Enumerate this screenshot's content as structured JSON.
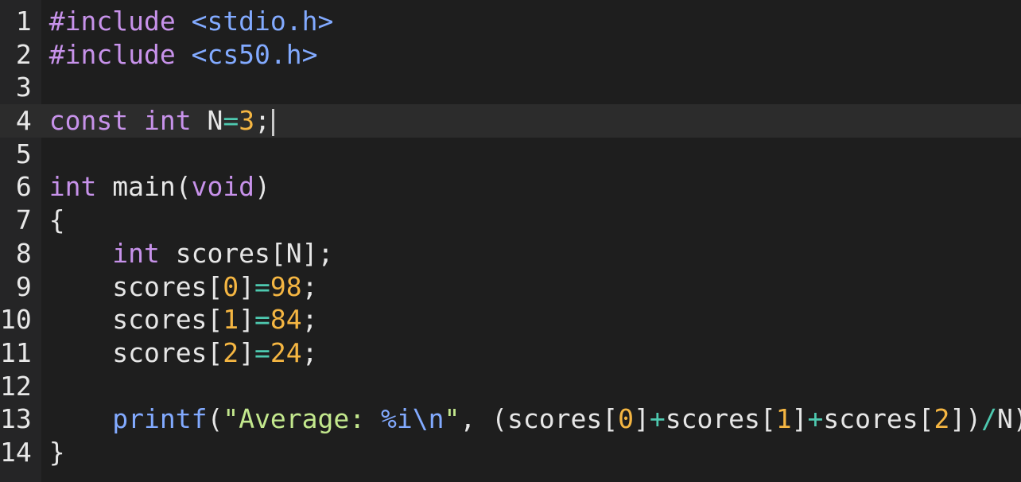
{
  "colors": {
    "background": "#1e1e1e",
    "gutter": "#252526",
    "keyword": "#c792ea",
    "directive": "#c792ea",
    "header": "#82aaff",
    "number": "#f5b642",
    "operator": "#4ec9b0",
    "plain": "#e6e6e6",
    "function": "#82aaff",
    "string": "#c3e88d"
  },
  "editor": {
    "active_line": 4,
    "line_numbers": [
      "1",
      "2",
      "3",
      "4",
      "5",
      "6",
      "7",
      "8",
      "9",
      "10",
      "11",
      "12",
      "13",
      "14"
    ],
    "lines": [
      [
        {
          "t": "#include",
          "c": "directive"
        },
        {
          "t": " ",
          "c": "plain"
        },
        {
          "t": "<stdio.h>",
          "c": "header"
        }
      ],
      [
        {
          "t": "#include",
          "c": "directive"
        },
        {
          "t": " ",
          "c": "plain"
        },
        {
          "t": "<cs50.h>",
          "c": "header"
        }
      ],
      [],
      [
        {
          "t": "const",
          "c": "keyword"
        },
        {
          "t": " ",
          "c": "plain"
        },
        {
          "t": "int",
          "c": "keyword"
        },
        {
          "t": " N",
          "c": "plain"
        },
        {
          "t": "=",
          "c": "operator"
        },
        {
          "t": "3",
          "c": "number"
        },
        {
          "t": ";",
          "c": "plain"
        }
      ],
      [],
      [
        {
          "t": "int",
          "c": "keyword"
        },
        {
          "t": " main(",
          "c": "plain"
        },
        {
          "t": "void",
          "c": "keyword"
        },
        {
          "t": ")",
          "c": "plain"
        }
      ],
      [
        {
          "t": "{",
          "c": "plain"
        }
      ],
      [
        {
          "t": "    ",
          "c": "plain"
        },
        {
          "t": "int",
          "c": "keyword"
        },
        {
          "t": " scores[N];",
          "c": "plain"
        }
      ],
      [
        {
          "t": "    scores[",
          "c": "plain"
        },
        {
          "t": "0",
          "c": "number"
        },
        {
          "t": "]",
          "c": "plain"
        },
        {
          "t": "=",
          "c": "operator"
        },
        {
          "t": "98",
          "c": "number"
        },
        {
          "t": ";",
          "c": "plain"
        }
      ],
      [
        {
          "t": "    scores[",
          "c": "plain"
        },
        {
          "t": "1",
          "c": "number"
        },
        {
          "t": "]",
          "c": "plain"
        },
        {
          "t": "=",
          "c": "operator"
        },
        {
          "t": "84",
          "c": "number"
        },
        {
          "t": ";",
          "c": "plain"
        }
      ],
      [
        {
          "t": "    scores[",
          "c": "plain"
        },
        {
          "t": "2",
          "c": "number"
        },
        {
          "t": "]",
          "c": "plain"
        },
        {
          "t": "=",
          "c": "operator"
        },
        {
          "t": "24",
          "c": "number"
        },
        {
          "t": ";",
          "c": "plain"
        }
      ],
      [],
      [
        {
          "t": "    ",
          "c": "plain"
        },
        {
          "t": "printf",
          "c": "function"
        },
        {
          "t": "(",
          "c": "plain"
        },
        {
          "t": "\"Average: ",
          "c": "string"
        },
        {
          "t": "%i",
          "c": "header"
        },
        {
          "t": "\\n",
          "c": "header"
        },
        {
          "t": "\"",
          "c": "string"
        },
        {
          "t": ", (scores[",
          "c": "plain"
        },
        {
          "t": "0",
          "c": "number"
        },
        {
          "t": "]",
          "c": "plain"
        },
        {
          "t": "+",
          "c": "operator"
        },
        {
          "t": "scores[",
          "c": "plain"
        },
        {
          "t": "1",
          "c": "number"
        },
        {
          "t": "]",
          "c": "plain"
        },
        {
          "t": "+",
          "c": "operator"
        },
        {
          "t": "scores[",
          "c": "plain"
        },
        {
          "t": "2",
          "c": "number"
        },
        {
          "t": "])",
          "c": "plain"
        },
        {
          "t": "/",
          "c": "operator"
        },
        {
          "t": "N);",
          "c": "plain"
        }
      ],
      [
        {
          "t": "}",
          "c": "plain"
        }
      ]
    ]
  }
}
